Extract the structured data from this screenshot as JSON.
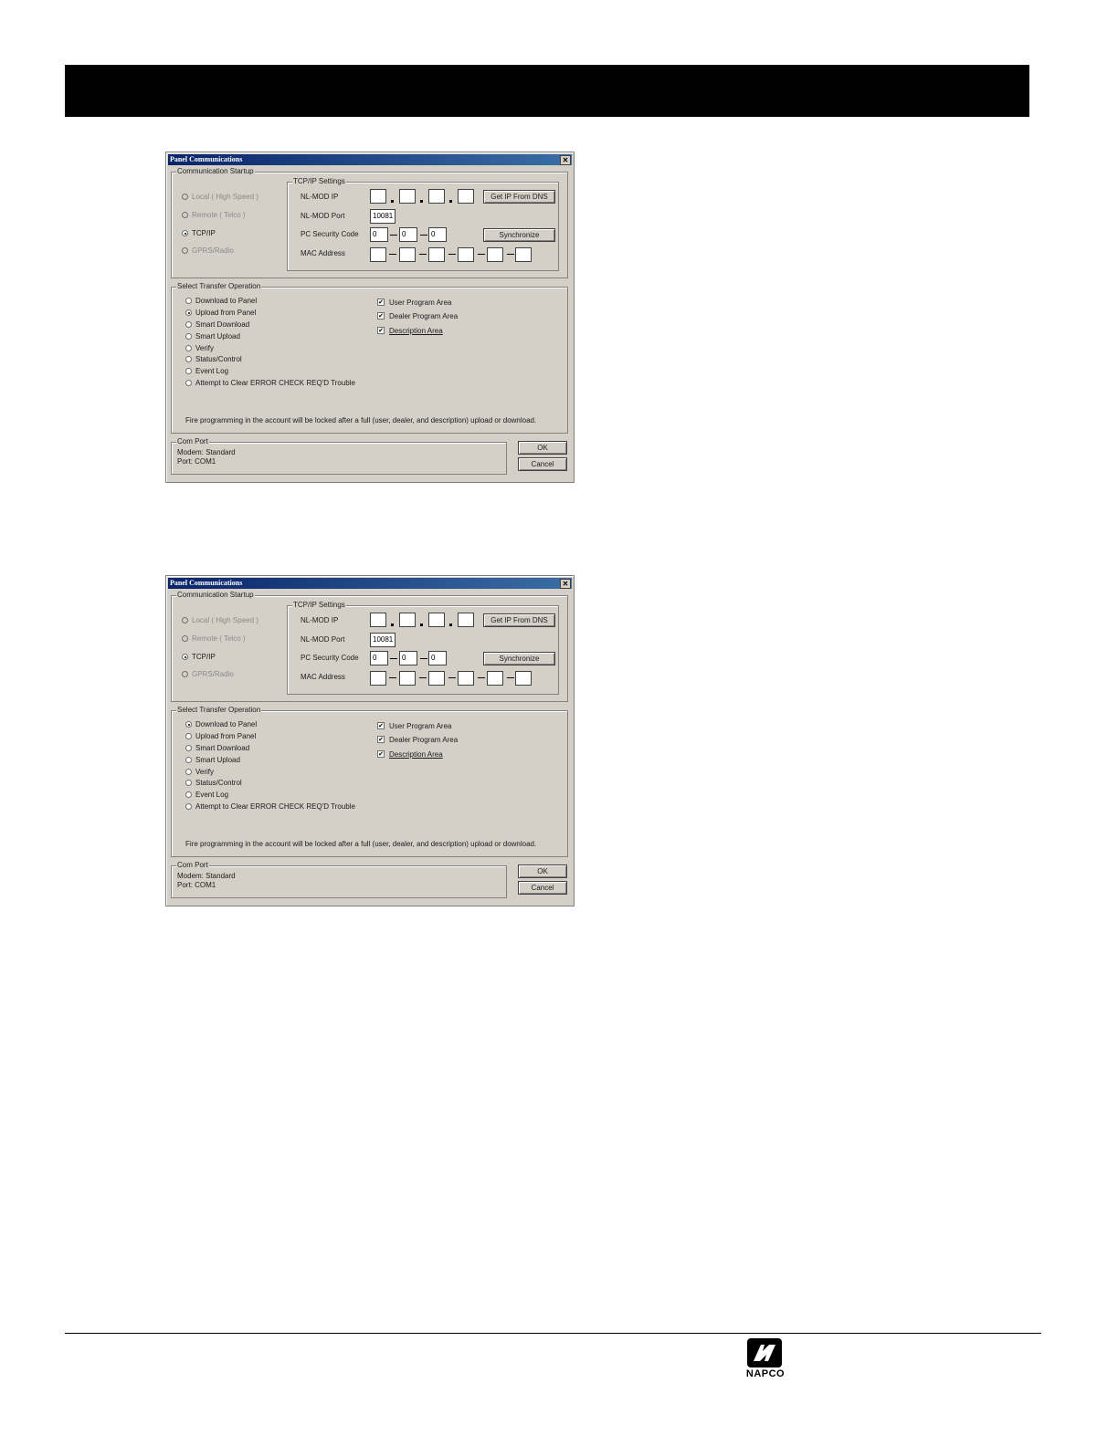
{
  "dialogs": [
    {
      "title": "Panel Communications",
      "close_label": "✕",
      "comm_startup": {
        "label": "Communication Startup",
        "options": [
          {
            "label": "Local ( High Speed )",
            "enabled": false,
            "selected": false
          },
          {
            "label": "Remote ( Telco )",
            "enabled": false,
            "selected": false
          },
          {
            "label": "TCP/IP",
            "enabled": true,
            "selected": true
          },
          {
            "label": "GPRS/Radio",
            "enabled": false,
            "selected": false
          }
        ]
      },
      "tcpip": {
        "label": "TCP/IP Settings",
        "ip_label": "NL-MOD IP",
        "ip_fields": [
          "",
          "",
          "",
          ""
        ],
        "port_label": "NL-MOD Port",
        "port_value": "10081",
        "security_label": "PC Security Code",
        "security_fields": [
          "0",
          "0",
          "0"
        ],
        "mac_label": "MAC Address",
        "mac_fields": [
          "",
          "",
          "",
          "",
          "",
          ""
        ],
        "get_ip_button": "Get IP From DNS",
        "sync_button": "Synchronize"
      },
      "transfer": {
        "label": "Select Transfer Operation",
        "options": [
          {
            "label": "Download to Panel",
            "selected": false
          },
          {
            "label": "Upload from Panel",
            "selected": true
          },
          {
            "label": "Smart Download",
            "selected": false
          },
          {
            "label": "Smart Upload",
            "selected": false
          },
          {
            "label": "Verify",
            "selected": false
          },
          {
            "label": "Status/Control",
            "selected": false
          },
          {
            "label": "Event Log",
            "selected": false
          },
          {
            "label": "Attempt to Clear ERROR CHECK REQ'D Trouble",
            "selected": false
          }
        ],
        "areas": [
          {
            "label": "User Program Area",
            "checked": true
          },
          {
            "label": "Dealer Program Area",
            "checked": true
          },
          {
            "label": "Description Area",
            "checked": true
          }
        ],
        "note": "Fire programming in the account will be locked after a full (user, dealer, and description) upload or download."
      },
      "com_port": {
        "label": "Com Port",
        "modem": "Modem: Standard",
        "port": "Port: COM1"
      },
      "ok_button": "OK",
      "cancel_button": "Cancel"
    },
    {
      "title": "Panel Communications",
      "close_label": "✕",
      "comm_startup": {
        "label": "Communication Startup",
        "options": [
          {
            "label": "Local ( High Speed )",
            "enabled": false,
            "selected": false
          },
          {
            "label": "Remote ( Telco )",
            "enabled": false,
            "selected": false
          },
          {
            "label": "TCP/IP",
            "enabled": true,
            "selected": true
          },
          {
            "label": "GPRS/Radio",
            "enabled": false,
            "selected": false
          }
        ]
      },
      "tcpip": {
        "label": "TCP/IP Settings",
        "ip_label": "NL-MOD IP",
        "ip_fields": [
          "",
          "",
          "",
          ""
        ],
        "port_label": "NL-MOD Port",
        "port_value": "10081",
        "security_label": "PC Security Code",
        "security_fields": [
          "0",
          "0",
          "0"
        ],
        "mac_label": "MAC Address",
        "mac_fields": [
          "",
          "",
          "",
          "",
          "",
          ""
        ],
        "get_ip_button": "Get IP From DNS",
        "sync_button": "Synchronize"
      },
      "transfer": {
        "label": "Select Transfer Operation",
        "options": [
          {
            "label": "Download to Panel",
            "selected": true
          },
          {
            "label": "Upload from Panel",
            "selected": false
          },
          {
            "label": "Smart Download",
            "selected": false
          },
          {
            "label": "Smart Upload",
            "selected": false
          },
          {
            "label": "Verify",
            "selected": false
          },
          {
            "label": "Status/Control",
            "selected": false
          },
          {
            "label": "Event Log",
            "selected": false
          },
          {
            "label": "Attempt to Clear ERROR CHECK REQ'D Trouble",
            "selected": false
          }
        ],
        "areas": [
          {
            "label": "User Program Area",
            "checked": true
          },
          {
            "label": "Dealer Program Area",
            "checked": true
          },
          {
            "label": "Description Area",
            "checked": true
          }
        ],
        "note": "Fire programming in the account will be locked after a full (user, dealer, and description) upload or download.",
        "note_unused": ""
      },
      "com_port": {
        "label": "Com Port",
        "modem": "Modem: Standard",
        "port": "Port: COM1"
      },
      "ok_button": "OK",
      "cancel_button": "Cancel"
    }
  ],
  "footer": {
    "logo_text": "NAPCO"
  }
}
